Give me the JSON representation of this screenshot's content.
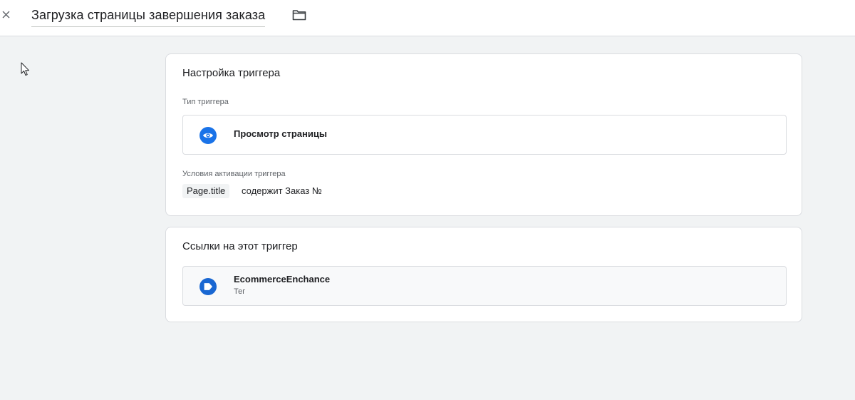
{
  "header": {
    "title": "Загрузка страницы завершения заказа"
  },
  "config_card": {
    "title": "Настройка триггера",
    "type_label": "Тип триггера",
    "trigger_type": "Просмотр страницы",
    "conditions_label": "Условия активации триггера",
    "condition": {
      "variable": "Page.title",
      "operator_value": "содержит Заказ №"
    }
  },
  "refs_card": {
    "title": "Ссылки на этот триггер",
    "items": [
      {
        "name": "EcommerceEnchance",
        "type": "Тег"
      }
    ]
  },
  "colors": {
    "accent_blue": "#1a73e8",
    "tag_blue": "#1967d2"
  }
}
